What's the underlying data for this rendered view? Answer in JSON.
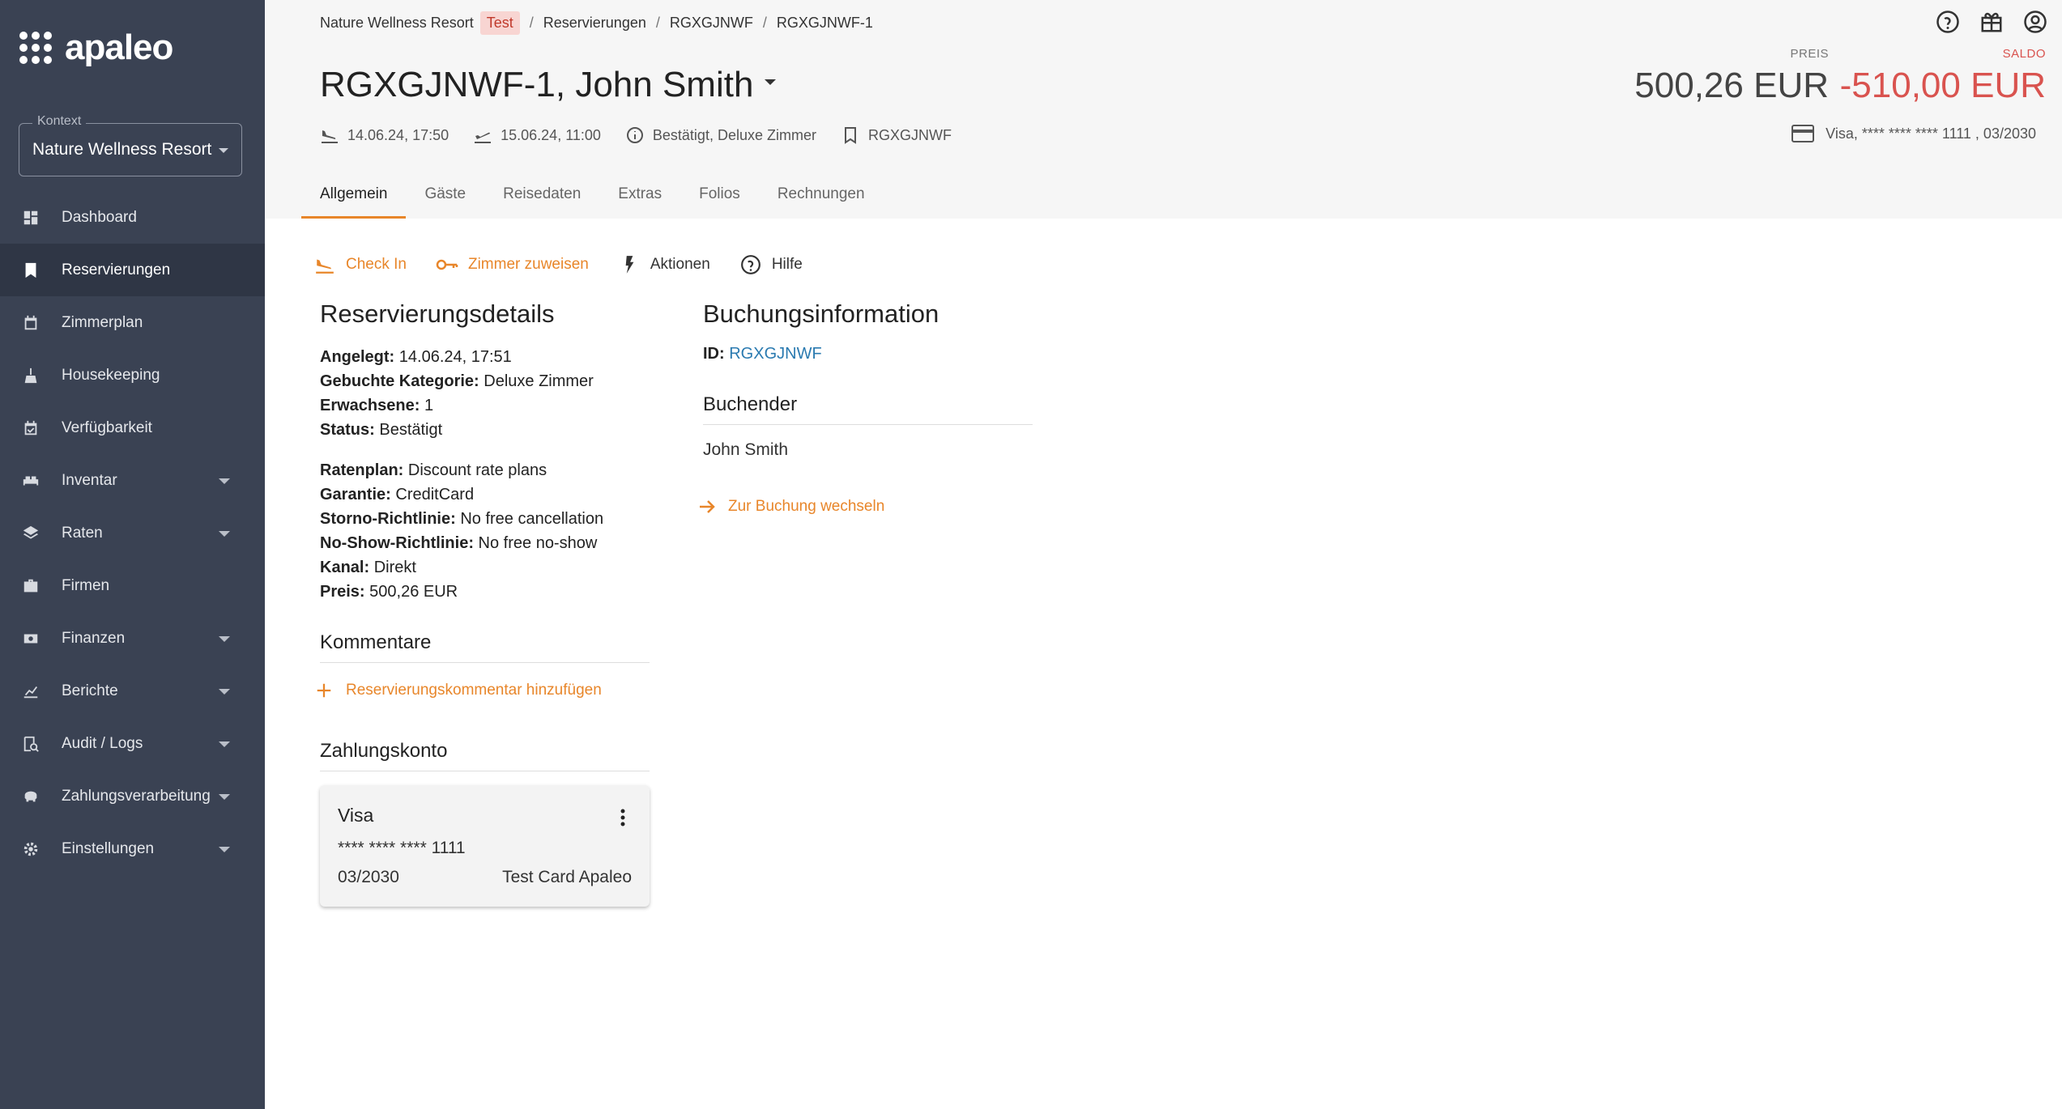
{
  "logo": {
    "text": "apaleo"
  },
  "context": {
    "label": "Kontext",
    "value": "Nature Wellness Resort"
  },
  "nav": [
    {
      "label": "Dashboard",
      "icon": "dashboard-icon",
      "active": false,
      "caret": false
    },
    {
      "label": "Reservierungen",
      "icon": "bookmark-icon",
      "active": true,
      "caret": false
    },
    {
      "label": "Zimmerplan",
      "icon": "calendar-icon",
      "active": false,
      "caret": false
    },
    {
      "label": "Housekeeping",
      "icon": "broom-icon",
      "active": false,
      "caret": false
    },
    {
      "label": "Verfügbarkeit",
      "icon": "calendar-check-icon",
      "active": false,
      "caret": false
    },
    {
      "label": "Inventar",
      "icon": "bed-icon",
      "active": false,
      "caret": true
    },
    {
      "label": "Raten",
      "icon": "layers-icon",
      "active": false,
      "caret": true
    },
    {
      "label": "Firmen",
      "icon": "briefcase-icon",
      "active": false,
      "caret": false
    },
    {
      "label": "Finanzen",
      "icon": "money-icon",
      "active": false,
      "caret": true
    },
    {
      "label": "Berichte",
      "icon": "chart-icon",
      "active": false,
      "caret": true
    },
    {
      "label": "Audit / Logs",
      "icon": "audit-icon",
      "active": false,
      "caret": true
    },
    {
      "label": "Zahlungsverarbeitung",
      "icon": "piggy-bank-icon",
      "active": false,
      "caret": true
    },
    {
      "label": "Einstellungen",
      "icon": "gear-icon",
      "active": false,
      "caret": true
    }
  ],
  "breadcrumb": {
    "property": "Nature Wellness Resort",
    "badge": "Test",
    "items": [
      "Reservierungen",
      "RGXGJNWF",
      "RGXGJNWF-1"
    ]
  },
  "header": {
    "title": "RGXGJNWF-1, John Smith",
    "arrival": "14.06.24, 17:50",
    "departure": "15.06.24, 11:00",
    "status": "Bestätigt, Deluxe Zimmer",
    "booking": "RGXGJNWF",
    "price_label": "PREIS",
    "price": "500,26 EUR",
    "saldo_label": "SALDO",
    "saldo": "-510,00 EUR",
    "card": "Visa, **** **** **** 1111 , 03/2030"
  },
  "tabs": [
    "Allgemein",
    "Gäste",
    "Reisedaten",
    "Extras",
    "Folios",
    "Rechnungen"
  ],
  "actions": {
    "checkin": "Check In",
    "assign_room": "Zimmer zuweisen",
    "actions": "Aktionen",
    "help": "Hilfe"
  },
  "details": {
    "title": "Reservierungsdetails",
    "created_label": "Angelegt:",
    "created": "14.06.24, 17:51",
    "category_label": "Gebuchte Kategorie:",
    "category": "Deluxe Zimmer",
    "adults_label": "Erwachsene:",
    "adults": "1",
    "status_label": "Status:",
    "status": "Bestätigt",
    "rateplan_label": "Ratenplan:",
    "rateplan": "Discount rate plans",
    "guarantee_label": "Garantie:",
    "guarantee": "CreditCard",
    "cancel_label": "Storno-Richtlinie:",
    "cancel": "No free cancellation",
    "noshow_label": "No-Show-Richtlinie:",
    "noshow": "No free no-show",
    "channel_label": "Kanal:",
    "channel": "Direkt",
    "price_label": "Preis:",
    "price": "500,26 EUR"
  },
  "comments": {
    "title": "Kommentare",
    "add": "Reservierungskommentar hinzufügen"
  },
  "payment": {
    "title": "Zahlungskonto",
    "type": "Visa",
    "number": "**** **** **** 1111",
    "expiry": "03/2030",
    "holder": "Test Card Apaleo"
  },
  "booking_info": {
    "title": "Buchungsinformation",
    "id_label": "ID:",
    "id": "RGXGJNWF",
    "booker_title": "Buchender",
    "booker": "John Smith",
    "go": "Zur Buchung wechseln"
  },
  "colors": {
    "accent": "#e8862a",
    "sidebar": "#3a4253",
    "negative": "#d9534f",
    "link": "#2a7ab0"
  }
}
